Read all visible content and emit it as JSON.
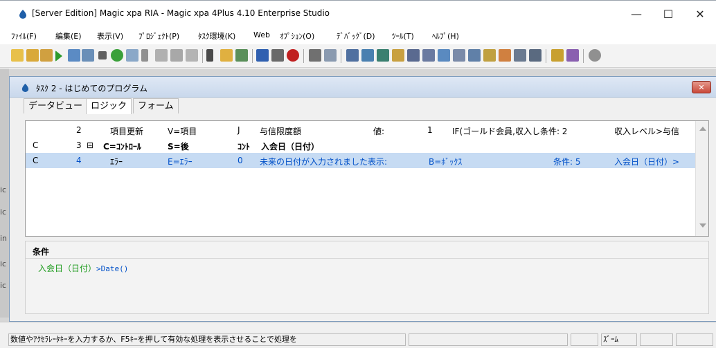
{
  "window": {
    "title": "[Server Edition] Magic xpa RIA - Magic xpa 4Plus 4.10 Enterprise Studio",
    "minimize_glyph": "—",
    "maximize_glyph": "☐",
    "close_glyph": "✕"
  },
  "menu": [
    "ﾌｧｲﾙ(F)",
    "編集(E)",
    "表示(V)",
    "ﾌﾟﾛｼﾞｪｸﾄ(P)",
    "ﾀｽｸ環境(K)",
    "Web",
    "ｵﾌﾟｼｮﾝ(O)",
    "ﾃﾞﾊﾞｯｸﾞ(D)",
    "ﾂｰﾙ(T)",
    "ﾍﾙﾌﾟ(H)"
  ],
  "side_fragments": [
    "ic",
    "ic",
    "in",
    "ic",
    "ic"
  ],
  "child": {
    "title": "ﾀｽｸ 2 -  はじめてのプログラム",
    "close_glyph": "✕",
    "tabs": [
      "データビュー",
      "ロジック",
      "フォーム"
    ]
  },
  "grid_rows": [
    {
      "c0": "",
      "c1": "2",
      "c2": "",
      "c3": "項目更新",
      "c4": "V=項目",
      "c5": "J",
      "c6": "与信限度額",
      "c7": "値:",
      "c8": "1",
      "c9": "IF(ゴールド会員,収入し条件: 2",
      "c10": "収入レベル>与信"
    },
    {
      "c0": "C",
      "c1": "3",
      "c2": "⊟",
      "c3": "C=ｺﾝﾄﾛｰﾙ",
      "c4": "S=後",
      "c5": "ｺﾝﾄ",
      "c6": "入会日（日付）",
      "c7": "",
      "c8": "",
      "c9": "",
      "c10": ""
    },
    {
      "c0": "C",
      "c1": "4",
      "c2": "",
      "c3": "ｴﾗｰ",
      "c4": "E=ｴﾗｰ",
      "c5": "0",
      "c6": "未来の日付が入力されました表示:",
      "c7": "B=ﾎﾞｯｸｽ",
      "c8": "",
      "c9": "条件: 5",
      "c10": "入会日（日付）>"
    }
  ],
  "condition": {
    "label": "条件",
    "expr_field": "入会日（日付）",
    "expr_op": ">Date()"
  },
  "status": {
    "message": "数値やｱｸｾﾗﾚｰﾀｷｰを入力するか、F5ｷｰを押して有効な処理を表示させることで処理を",
    "zoom": "ｽﾞｰﾑ"
  },
  "colors": {
    "accent_blue": "#0050c8",
    "field_green": "#1a9a1a",
    "selection": "#c6dbf3"
  }
}
